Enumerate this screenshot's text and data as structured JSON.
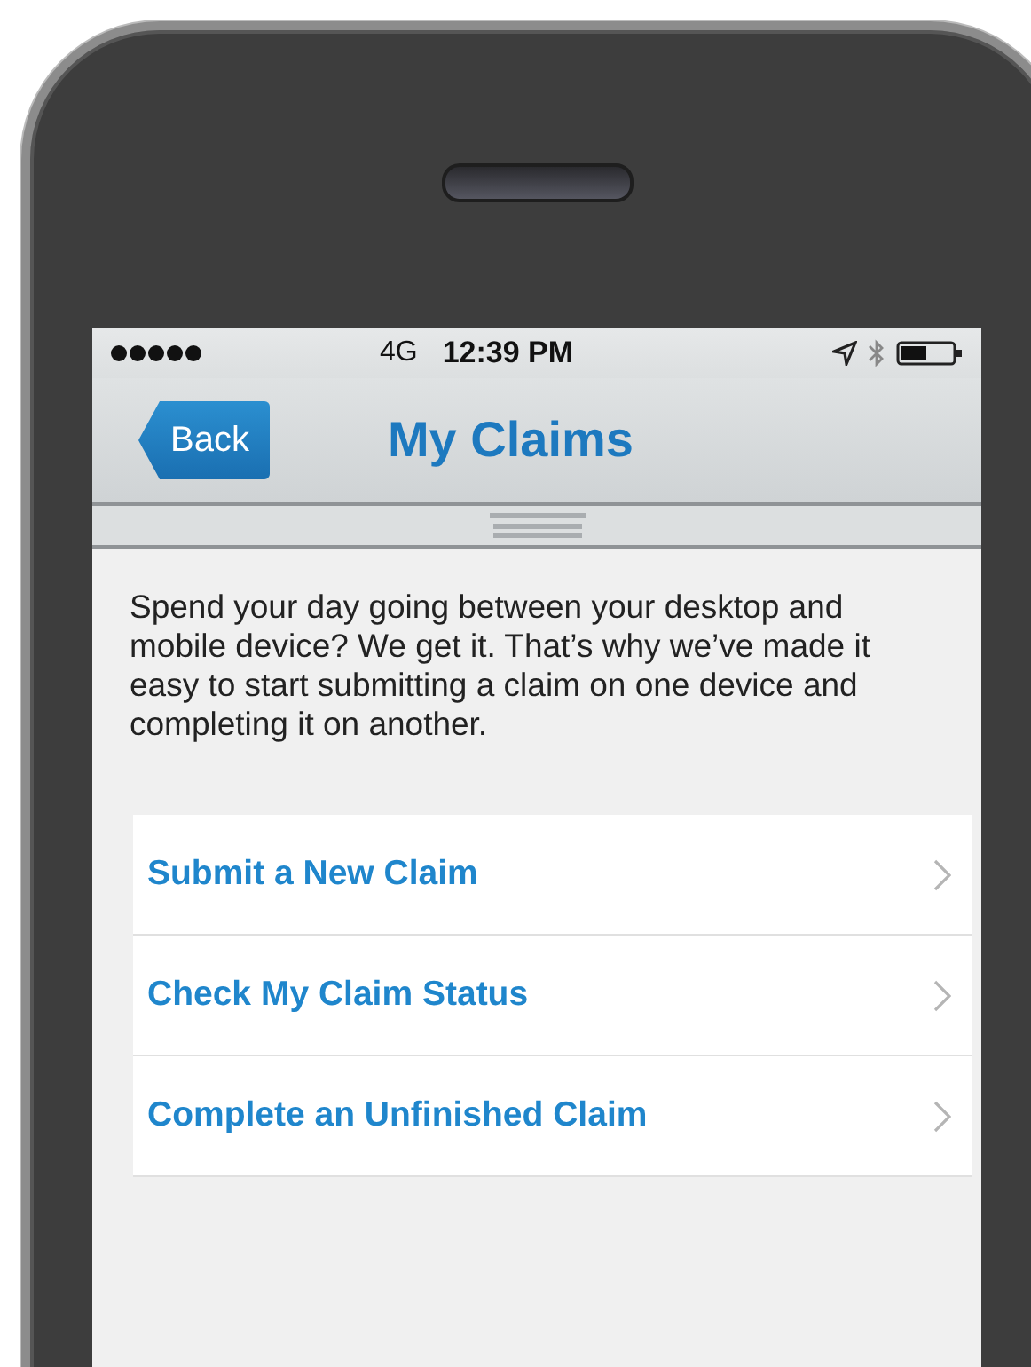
{
  "status_bar": {
    "network": "4G",
    "time": "12:39 PM"
  },
  "nav_bar": {
    "back": "Back",
    "title": "My Claims"
  },
  "intro": "Spend your day going between your desktop and mobile device? We get it. That’s why we’ve made it easy to start submitting a claim on one device and completing it on another.",
  "menu": [
    {
      "label": "Submit a New Claim"
    },
    {
      "label": "Check My Claim Status"
    },
    {
      "label": "Complete an Unfinished Claim"
    }
  ]
}
